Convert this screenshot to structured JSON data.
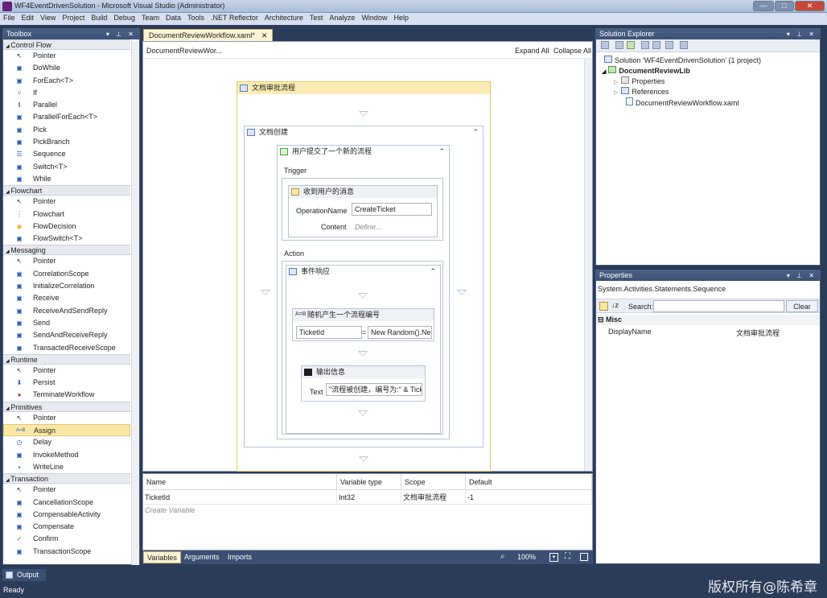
{
  "window": {
    "title": "WF4EventDrivenSolution - Microsoft Visual Studio (Administrator)",
    "minimize_glyph": "—",
    "maximize_glyph": "□",
    "close_glyph": "✕"
  },
  "menu": [
    "File",
    "Edit",
    "View",
    "Project",
    "Build",
    "Debug",
    "Team",
    "Data",
    "Tools",
    ".NET Reflector",
    "Architecture",
    "Test",
    "Analyze",
    "Window",
    "Help"
  ],
  "toolbox": {
    "title": "Toolbox",
    "sections": [
      {
        "label": "Control Flow",
        "items": [
          "Pointer",
          "DoWhile",
          "ForEach<T>",
          "If",
          "Parallel",
          "ParallelForEach<T>",
          "Pick",
          "PickBranch",
          "Sequence",
          "Switch<T>",
          "While"
        ]
      },
      {
        "label": "Flowchart",
        "items": [
          "Pointer",
          "Flowchart",
          "FlowDecision",
          "FlowSwitch<T>"
        ]
      },
      {
        "label": "Messaging",
        "items": [
          "Pointer",
          "CorrelationScope",
          "InitializeCorrelation",
          "Receive",
          "ReceiveAndSendReply",
          "Send",
          "SendAndReceiveReply",
          "TransactedReceiveScope"
        ]
      },
      {
        "label": "Runtime",
        "items": [
          "Pointer",
          "Persist",
          "TerminateWorkflow"
        ]
      },
      {
        "label": "Primitives",
        "items": [
          "Pointer",
          "Assign",
          "Delay",
          "InvokeMethod",
          "WriteLine"
        ]
      },
      {
        "label": "Transaction",
        "items": [
          "Pointer",
          "CancellationScope",
          "CompensableActivity",
          "Compensate",
          "Confirm",
          "TransactionScope"
        ]
      }
    ],
    "selected_item": "Assign"
  },
  "document": {
    "tab_label": "DocumentReviewWorkflow.xaml*",
    "tab_close": "✕",
    "breadcrumb": "DocumentReviewWor...",
    "expand_all": "Expand All",
    "collapse_all": "Collapse All"
  },
  "workflow": {
    "root_title": "文档审批流程",
    "pick_title": "文档创建",
    "branch_title": "用户提交了一个新的流程",
    "trigger_label": "Trigger",
    "receive_title": "收到用户的消息",
    "operation_label": "OperationName",
    "operation_value": "CreateTicket",
    "content_label": "Content",
    "content_placeholder": "Define...",
    "action_label": "Action",
    "sequence_title": "事件响应",
    "assign_title": "随机产生一个流程编号",
    "assign_to": "TicketId",
    "assign_eq": "=",
    "assign_value": "New Random().Ne",
    "writeline_title": "输出信息",
    "text_label": "Text",
    "text_value": "\"流程被创建，编号为:\" & Tick"
  },
  "variables": {
    "headers": [
      "Name",
      "Variable type",
      "Scope",
      "Default"
    ],
    "rows": [
      [
        "TicketId",
        "Int32",
        "文档审批流程",
        "-1"
      ]
    ],
    "create_label": "Create Variable"
  },
  "designer_bar": {
    "tabs": [
      "Variables",
      "Arguments",
      "Imports"
    ],
    "zoom": "100%"
  },
  "solution_explorer": {
    "title": "Solution Explorer",
    "solution": "Solution 'WF4EventDrivenSolution' (1 project)",
    "project": "DocumentReviewLib",
    "items": [
      "Properties",
      "References",
      "DocumentReviewWorkflow.xaml"
    ]
  },
  "properties": {
    "title": "Properties",
    "type": "System.Activities.Statements.Sequence",
    "search_label": "Search:",
    "clear_label": "Clear",
    "category": "Misc",
    "prop_name": "DisplayName",
    "prop_value": "文档审批流程"
  },
  "output_tab": "Output",
  "status": "Ready",
  "watermark": "版权所有@陈希章"
}
